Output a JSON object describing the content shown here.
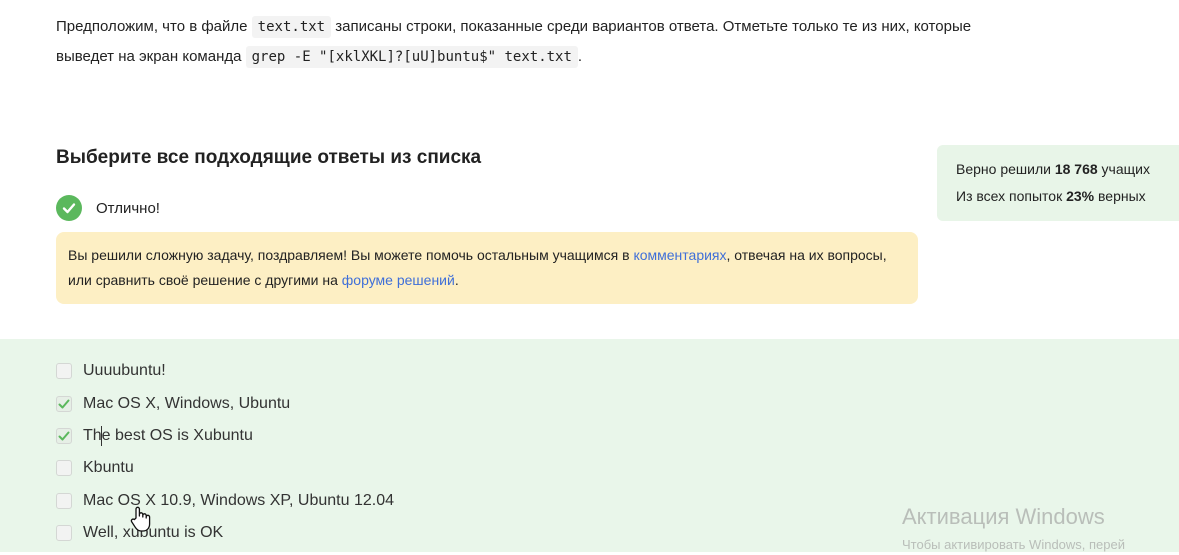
{
  "question": {
    "line1_text": "Предположим, что в файле ",
    "filename": "text.txt",
    "line1_rest": " записаны строки, показанные среди вариантов ответа. Отметьте только те из них, которые",
    "line2_text": "выведет на экран команда ",
    "command": "grep -E \"[xklXKL]?[uU]buntu$\" text.txt",
    "line2_end": "."
  },
  "section_heading": "Выберите все подходящие ответы из списка",
  "status": {
    "label": "Отлично!",
    "color": "#5bb85d",
    "icon": "check-circle-icon"
  },
  "note": {
    "text1": "Вы решили сложную задачу, поздравляем! Вы можете помочь остальным учащимся в ",
    "link1": "комментариях",
    "text2": ", отвечая на их вопросы, или сравнить своё решение с другими на ",
    "link2": "форуме решений",
    "text3": "."
  },
  "stats": {
    "line1_prefix": "Верно решили ",
    "line1_value": "18 768",
    "line1_suffix": " учащих",
    "line2_prefix": "Из всех попыток ",
    "line2_value": "23%",
    "line2_suffix": " верных"
  },
  "options": [
    {
      "label": "Uuuubuntu!",
      "checked": false
    },
    {
      "label": "Mac OS X, Windows, Ubuntu",
      "checked": true
    },
    {
      "label": "The best OS is Xubuntu",
      "checked": true
    },
    {
      "label": "Kbuntu",
      "checked": false
    },
    {
      "label": "Mac OS X 10.9, Windows XP, Ubuntu 12.04",
      "checked": false
    },
    {
      "label": "Well, xubuntu is OK",
      "checked": false
    }
  ],
  "watermark": {
    "title": "Активация Windows",
    "subtitle": "Чтобы активировать Windows, перей"
  }
}
